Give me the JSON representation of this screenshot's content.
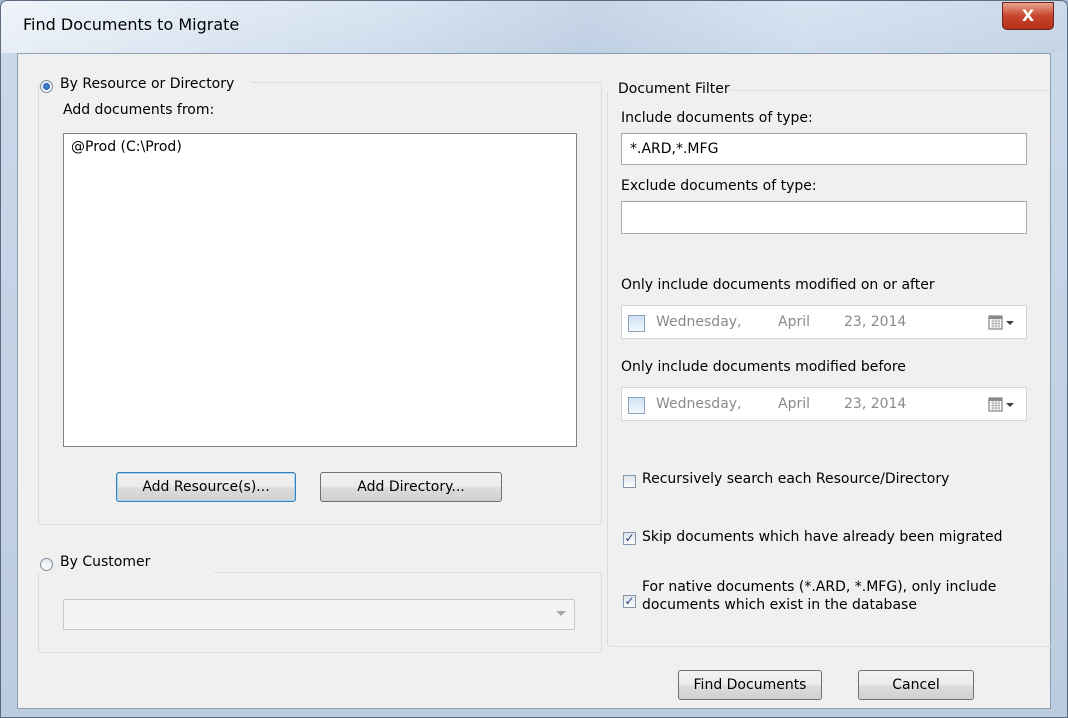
{
  "window": {
    "title": "Find Documents to Migrate",
    "close_glyph": "X"
  },
  "left_panel": {
    "by_resource_label": "By Resource or Directory",
    "add_docs_label": "Add documents from:",
    "list_items": [
      "@Prod  (C:\\Prod)"
    ],
    "add_resource_button": "Add Resource(s)...",
    "add_directory_button": "Add Directory...",
    "by_customer_label": "By Customer",
    "customer_select_value": "",
    "by_resource_selected": true,
    "by_customer_selected": false
  },
  "filter": {
    "group_label": "Document Filter",
    "include_label": "Include documents of type:",
    "include_value": "*.ARD,*.MFG",
    "exclude_label": "Exclude documents of type:",
    "exclude_value": "",
    "after_label": "Only include documents modified on or after",
    "after_date": {
      "weekday": "Wednesday,",
      "month": "April",
      "day_year": "23, 2014",
      "enabled": false
    },
    "before_label": "Only include documents modified before",
    "before_date": {
      "weekday": "Wednesday,",
      "month": "April",
      "day_year": "23, 2014",
      "enabled": false
    },
    "recursive_label": "Recursively search each Resource/Directory",
    "recursive_checked": false,
    "skip_label": "Skip documents which have already been migrated",
    "skip_checked": true,
    "native_label_line1": "For native documents (*.ARD, *.MFG), only include",
    "native_label_line2": "documents which exist in the database",
    "native_checked": true
  },
  "footer": {
    "find_button": "Find Documents",
    "cancel_button": "Cancel"
  },
  "colors": {
    "close_button": "#c7452c",
    "check_mark": "#1f3d7a",
    "radio_dot": "#0f4fa3"
  },
  "icons": {
    "checkmark": "check-icon",
    "calendar": "calendar-dropdown-icon"
  }
}
